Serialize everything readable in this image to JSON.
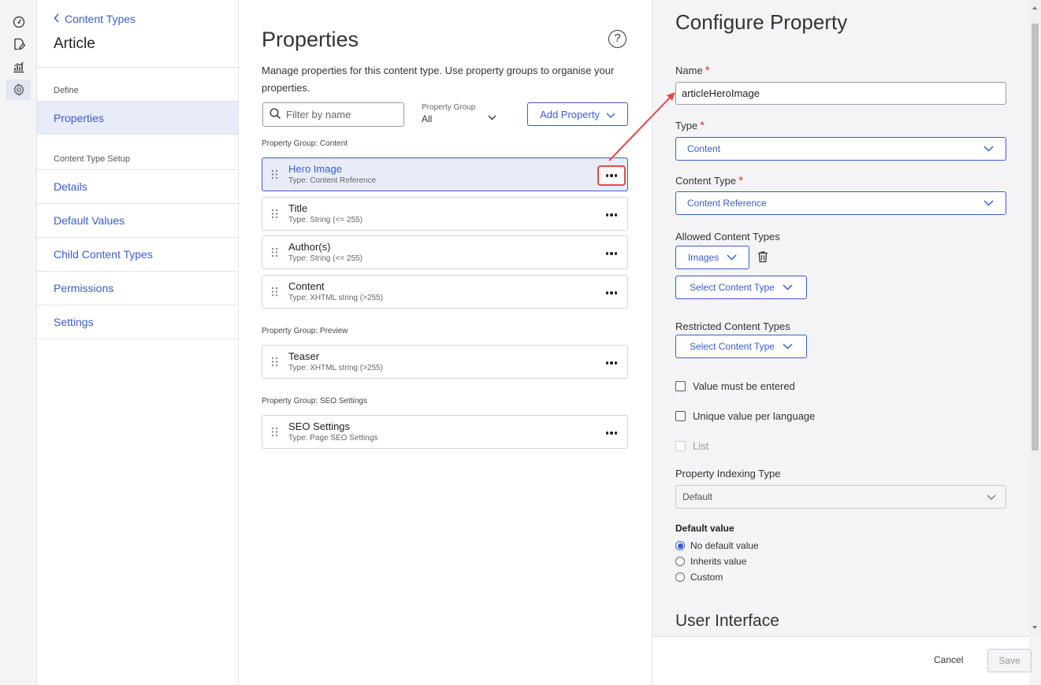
{
  "rail": {
    "icons": [
      "dashboard-icon",
      "edit-document-icon",
      "analytics-icon",
      "settings-gear-icon"
    ]
  },
  "nav": {
    "back_label": "Content Types",
    "title": "Article",
    "section_define": "Define",
    "properties_label": "Properties",
    "section_setup": "Content Type Setup",
    "items": [
      {
        "label": "Details"
      },
      {
        "label": "Default Values"
      },
      {
        "label": "Child Content Types"
      },
      {
        "label": "Permissions"
      },
      {
        "label": "Settings"
      }
    ]
  },
  "main": {
    "title": "Properties",
    "help": "?",
    "description": "Manage properties for this content type. Use property groups to organise your properties.",
    "filter_placeholder": "Filter by name",
    "property_group_label": "Property Group",
    "property_group_value": "All",
    "add_property_label": "Add Property",
    "groups": [
      {
        "label": "Property Group: Content",
        "props": [
          {
            "name": "Hero Image",
            "type": "Type: Content Reference"
          },
          {
            "name": "Title",
            "type": "Type: String (<= 255)"
          },
          {
            "name": "Author(s)",
            "type": "Type: String (<= 255)"
          },
          {
            "name": "Content",
            "type": "Type: XHTML string (>255)"
          }
        ]
      },
      {
        "label": "Property Group: Preview",
        "props": [
          {
            "name": "Teaser",
            "type": "Type: XHTML string (>255)"
          }
        ]
      },
      {
        "label": "Property Group: SEO Settings",
        "props": [
          {
            "name": "SEO Settings",
            "type": "Type: Page SEO Settings"
          }
        ]
      }
    ]
  },
  "config": {
    "title": "Configure Property",
    "name_label": "Name",
    "name_value": "articleHeroImage",
    "type_label": "Type",
    "type_value": "Content",
    "content_type_label": "Content Type",
    "content_type_value": "Content Reference",
    "allowed_label": "Allowed Content Types",
    "allowed_value": "Images",
    "select_content_type": "Select Content Type",
    "restricted_label": "Restricted Content Types",
    "restricted_select": "Select Content Type",
    "required_mark": "*",
    "checks": [
      {
        "label": "Value must be entered",
        "checked": false,
        "disabled": false
      },
      {
        "label": "Unique value per language",
        "checked": false,
        "disabled": false
      },
      {
        "label": "List",
        "checked": false,
        "disabled": true
      }
    ],
    "indexing_label": "Property Indexing Type",
    "indexing_value": "Default",
    "default_value_title": "Default value",
    "radios": [
      {
        "label": "No default value",
        "selected": true
      },
      {
        "label": "Inherits value",
        "selected": false
      },
      {
        "label": "Custom",
        "selected": false
      }
    ],
    "ui_heading": "User Interface",
    "cancel_label": "Cancel",
    "save_label": "Save"
  },
  "colors": {
    "accent": "#3b5bd6",
    "highlight": "#e5484d",
    "selected_bg": "#e8ebf8"
  }
}
